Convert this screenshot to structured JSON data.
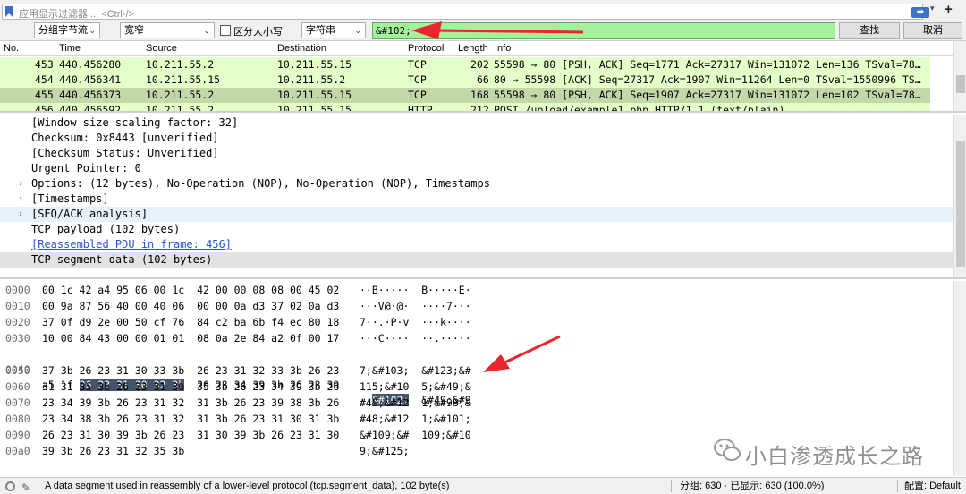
{
  "filter_bar": {
    "placeholder": "应用显示过滤器 ... <Ctrl-/>",
    "apply_icon": "arrow-right-icon",
    "plus_label": "+"
  },
  "find_bar": {
    "search_in": "分组字节流",
    "char_width": "宽窄",
    "case_sensitive_label": "区分大小写",
    "search_type": "字符串",
    "search_value": "&#102;",
    "find_button": "查找",
    "cancel_button": "取消"
  },
  "packet_list": {
    "columns": [
      "No.",
      "Time",
      "Source",
      "Destination",
      "Protocol",
      "Length",
      "Info"
    ],
    "rows": [
      {
        "no": "453",
        "time": "440.456280",
        "src": "10.211.55.2",
        "dst": "10.211.55.15",
        "proto": "TCP",
        "len": "202",
        "info": "55598 → 80 [PSH, ACK] Seq=1771 Ack=27317 Win=131072 Len=136 TSval=78…"
      },
      {
        "no": "454",
        "time": "440.456341",
        "src": "10.211.55.15",
        "dst": "10.211.55.2",
        "proto": "TCP",
        "len": "66",
        "info": "80 → 55598 [ACK] Seq=27317 Ack=1907 Win=11264 Len=0 TSval=1550996 TS…"
      },
      {
        "no": "455",
        "time": "440.456373",
        "src": "10.211.55.2",
        "dst": "10.211.55.15",
        "proto": "TCP",
        "len": "168",
        "info": "55598 → 80 [PSH, ACK] Seq=1907 Ack=27317 Win=131072 Len=102 TSval=78…"
      },
      {
        "no": "456",
        "time": "440.456592",
        "src": "10.211.55.2",
        "dst": "10.211.55.15",
        "proto": "HTTP",
        "len": "212",
        "info": "POST /upload/example1.php HTTP/1.1  (text/plain)"
      }
    ]
  },
  "details": [
    {
      "text": "[Window size scaling factor: 32]"
    },
    {
      "text": "Checksum: 0x8443 [unverified]"
    },
    {
      "text": "[Checksum Status: Unverified]"
    },
    {
      "text": "Urgent Pointer: 0"
    },
    {
      "text": "Options: (12 bytes), No-Operation (NOP), No-Operation (NOP), Timestamps"
    },
    {
      "text": "[Timestamps]"
    },
    {
      "text": "[SEQ/ACK analysis]"
    },
    {
      "text": "TCP payload (102 bytes)"
    },
    {
      "text": "[Reassembled PDU in frame: 456]"
    },
    {
      "text": "TCP segment data (102 bytes)"
    }
  ],
  "bytes": [
    {
      "off": "0000",
      "hex": "00 1c 42 a4 95 06 00 1c  42 00 00 08 08 00 45 02",
      "asc": "··B·····  B·····E·"
    },
    {
      "off": "0010",
      "hex": "00 9a 87 56 40 00 40 06  00 00 0a d3 37 02 0a d3",
      "asc": "···V@·@·  ····7···"
    },
    {
      "off": "0020",
      "hex": "37 0f d9 2e 00 50 cf 76  84 c2 ba 6b f4 ec 80 18",
      "asc": "7··.·P·v  ···k····"
    },
    {
      "off": "0030",
      "hex": "10 00 84 43 00 00 01 01  08 0a 2e 84 a2 0f 00 17",
      "asc": "···C····  ··.·····"
    },
    {
      "off": "0040",
      "hex_pre": "a5 1f ",
      "hex_hl": "26 23 31 30 32 3b",
      "hex_post": "  26 23 34 39 3b 26 23 39",
      "asc_pre": "··",
      "asc_hl": "&#102;",
      "asc_post": "  &#49;&#9"
    },
    {
      "off": "0050",
      "hex": "37 3b 26 23 31 30 33 3b  26 23 31 32 33 3b 26 23",
      "asc": "7;&#103;  &#123;&#"
    },
    {
      "off": "0060",
      "hex": "31 31 35 3b 26 23 31 30  35 3b 26 23 34 39 3b 26",
      "asc": "115;&#10  5;&#49;&"
    },
    {
      "off": "0070",
      "hex": "23 34 39 3b 26 23 31 32  31 3b 26 23 39 38 3b 26",
      "asc": "#49;&#12  1;&#98;&"
    },
    {
      "off": "0080",
      "hex": "23 34 38 3b 26 23 31 32  31 3b 26 23 31 30 31 3b",
      "asc": "#48;&#12  1;&#101;"
    },
    {
      "off": "0090",
      "hex": "26 23 31 30 39 3b 26 23  31 30 39 3b 26 23 31 30",
      "asc": "&#109;&#  109;&#10"
    },
    {
      "off": "00a0",
      "hex": "39 3b 26 23 31 32 35 3b",
      "asc": "9;&#125;"
    }
  ],
  "status": {
    "message": "A data segment used in reassembly of a lower-level protocol (tcp.segment_data), 102 byte(s)",
    "packets": "分组: 630 · 已显示: 630 (100.0%)",
    "profile": "配置: Default"
  },
  "watermark": {
    "text": "小白渗透成长之路",
    "icon": "wechat-logo-icon"
  },
  "colors": {
    "tcp_row": "#e4ffc7",
    "selected_row": "#c4d7a8",
    "find_input": "#a3f19c",
    "highlight_bytes": "#44546a",
    "annotation_arrow": "#e8262c"
  }
}
